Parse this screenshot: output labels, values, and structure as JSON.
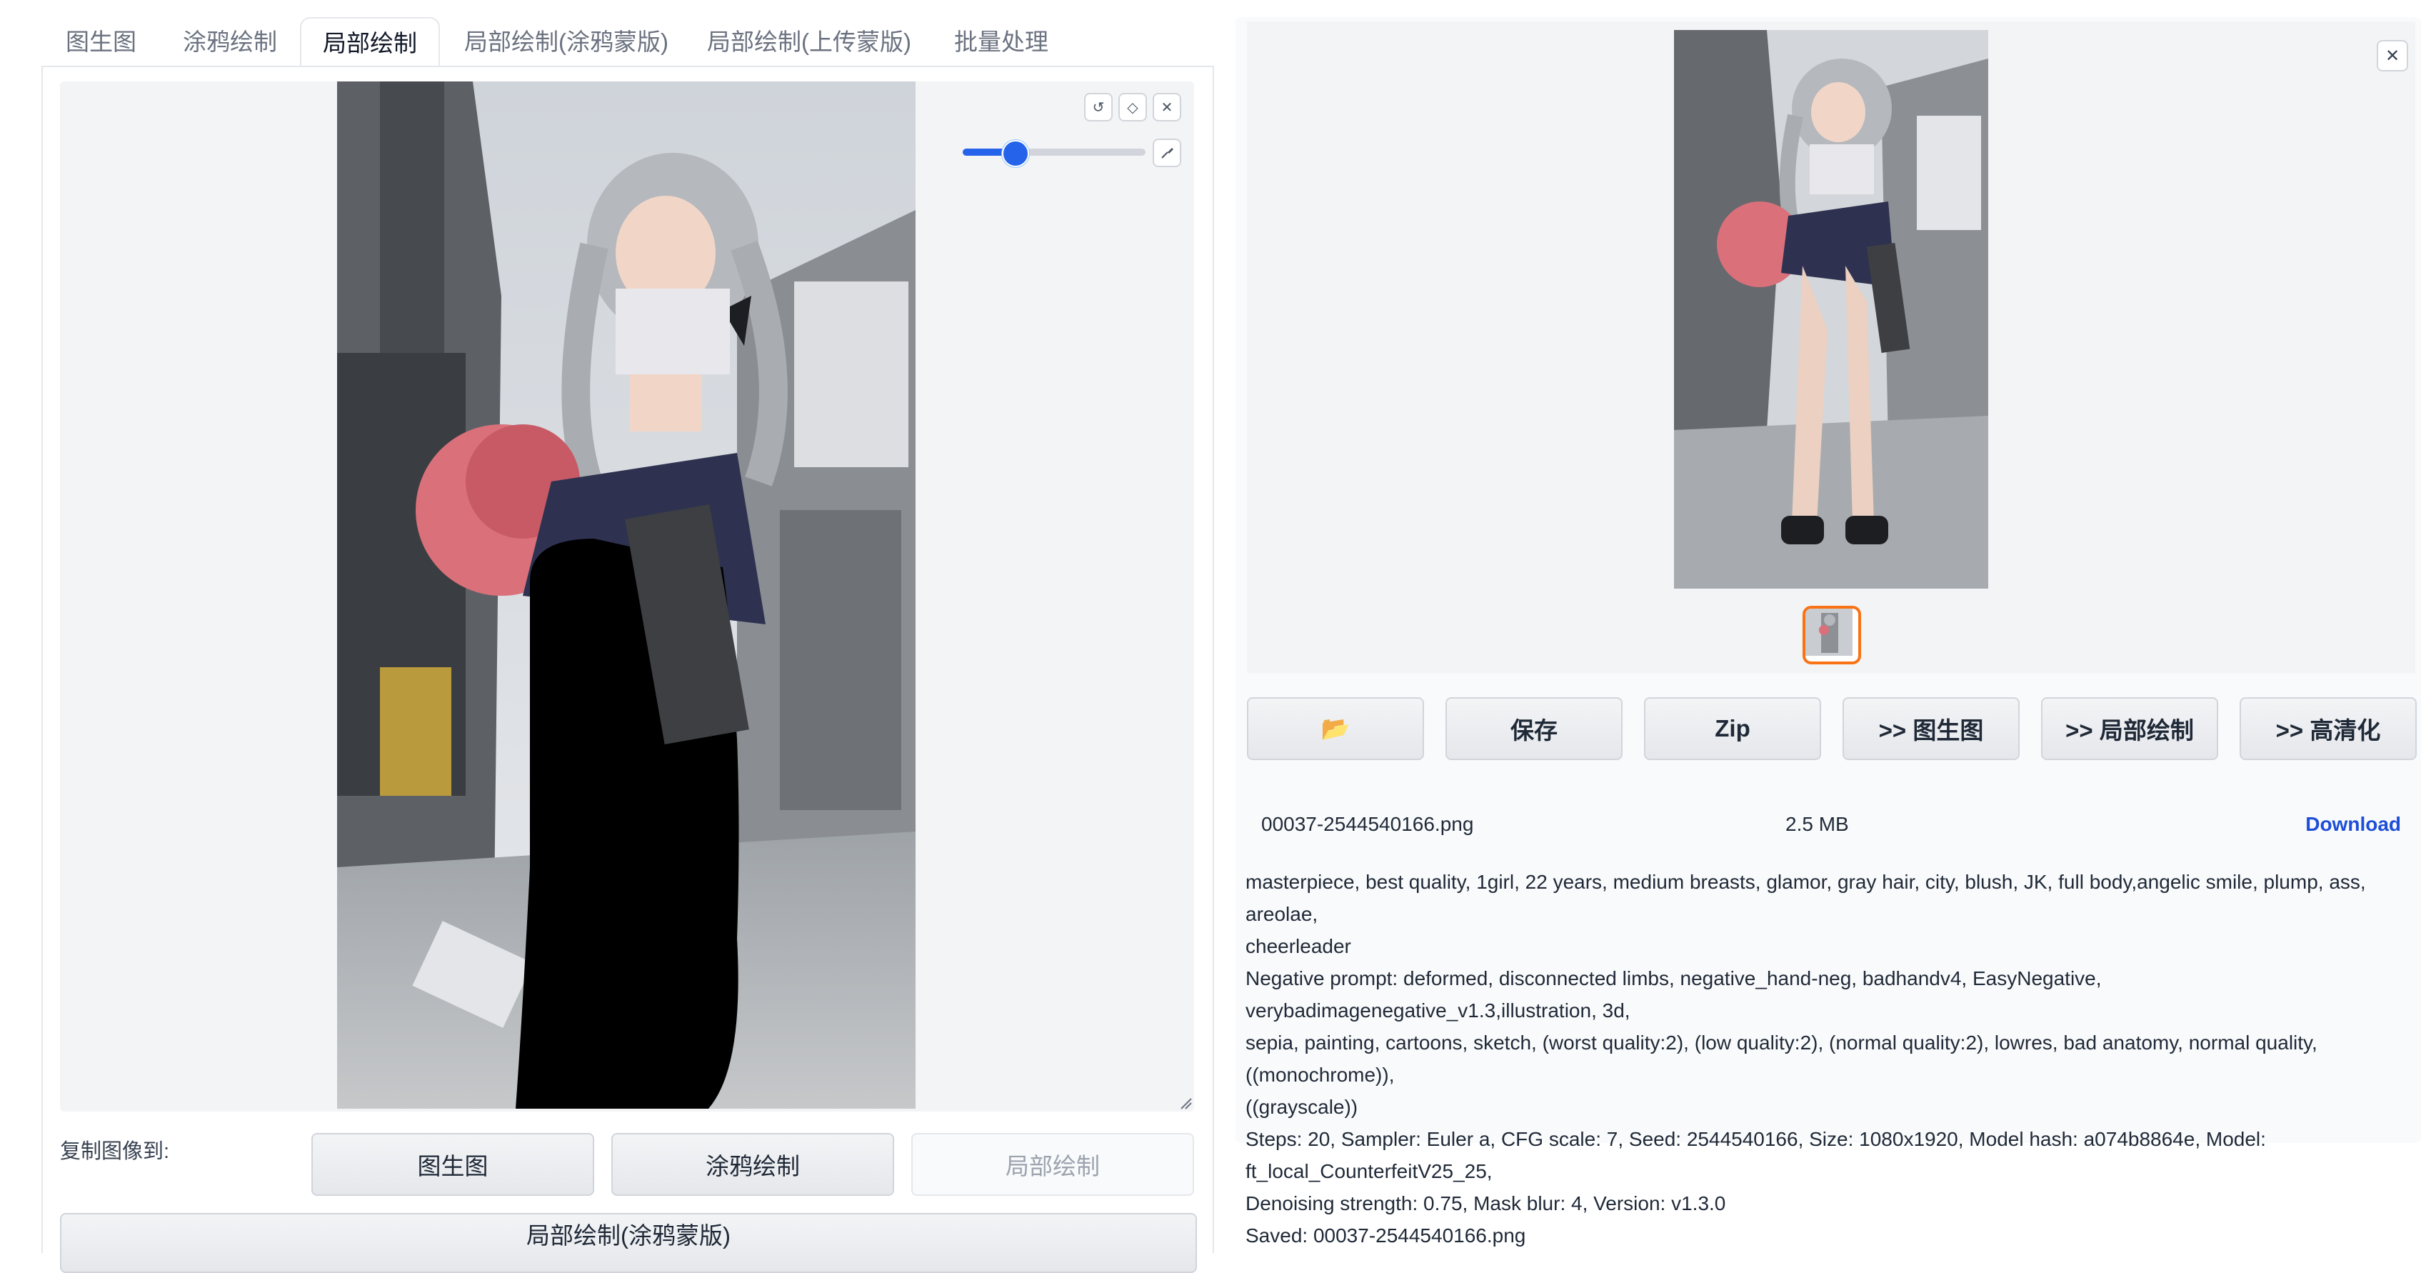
{
  "tabs": [
    {
      "label": "图生图"
    },
    {
      "label": "涂鸦绘制"
    },
    {
      "label": "局部绘制"
    },
    {
      "label": "局部绘制(涂鸦蒙版)"
    },
    {
      "label": "局部绘制(上传蒙版)"
    },
    {
      "label": "批量处理"
    }
  ],
  "active_tab_index": 2,
  "canvas": {
    "tools": {
      "undo": "↺",
      "clear": "◇",
      "close": "✕"
    },
    "brush_size_fraction": 0.28,
    "brush_icon": "brush-icon"
  },
  "copy_to": {
    "label": "复制图像到:",
    "buttons": [
      {
        "label": "图生图",
        "enabled": true
      },
      {
        "label": "涂鸦绘制",
        "enabled": true
      },
      {
        "label": "局部绘制",
        "enabled": false
      }
    ],
    "next_label": "局部绘制(涂鸦蒙版)"
  },
  "output": {
    "close_label": "✕",
    "buttons": [
      {
        "label": "📂",
        "icon": "folder-icon"
      },
      {
        "label": "保存"
      },
      {
        "label": "Zip"
      },
      {
        "label": ">> 图生图"
      },
      {
        "label": ">> 局部绘制"
      },
      {
        "label": ">> 高清化"
      }
    ],
    "file": {
      "name": "00037-2544540166.png",
      "size": "2.5 MB",
      "download": "Download"
    },
    "info_lines": [
      "masterpiece, best quality, 1girl, 22 years, medium breasts, glamor, gray hair, city, blush, JK, full body,angelic smile, plump, ass, areolae,",
      "cheerleader",
      "Negative prompt: deformed, disconnected limbs, negative_hand-neg, badhandv4, EasyNegative, verybadimagenegative_v1.3,illustration, 3d,",
      "sepia, painting, cartoons, sketch, (worst quality:2), (low quality:2), (normal quality:2), lowres, bad anatomy, normal quality, ((monochrome)),",
      "((grayscale))",
      "Steps: 20, Sampler: Euler a, CFG scale: 7, Seed: 2544540166, Size: 1080x1920, Model hash: a074b8864e, Model: ft_local_CounterfeitV25_25,",
      "Denoising strength: 0.75, Mask blur: 4, Version: v1.3.0",
      "Saved: 00037-2544540166.png"
    ]
  },
  "colors": {
    "accent": "#2563eb",
    "thumb_border": "#f97316",
    "download": "#1d4ed8",
    "mask": "#000000"
  }
}
